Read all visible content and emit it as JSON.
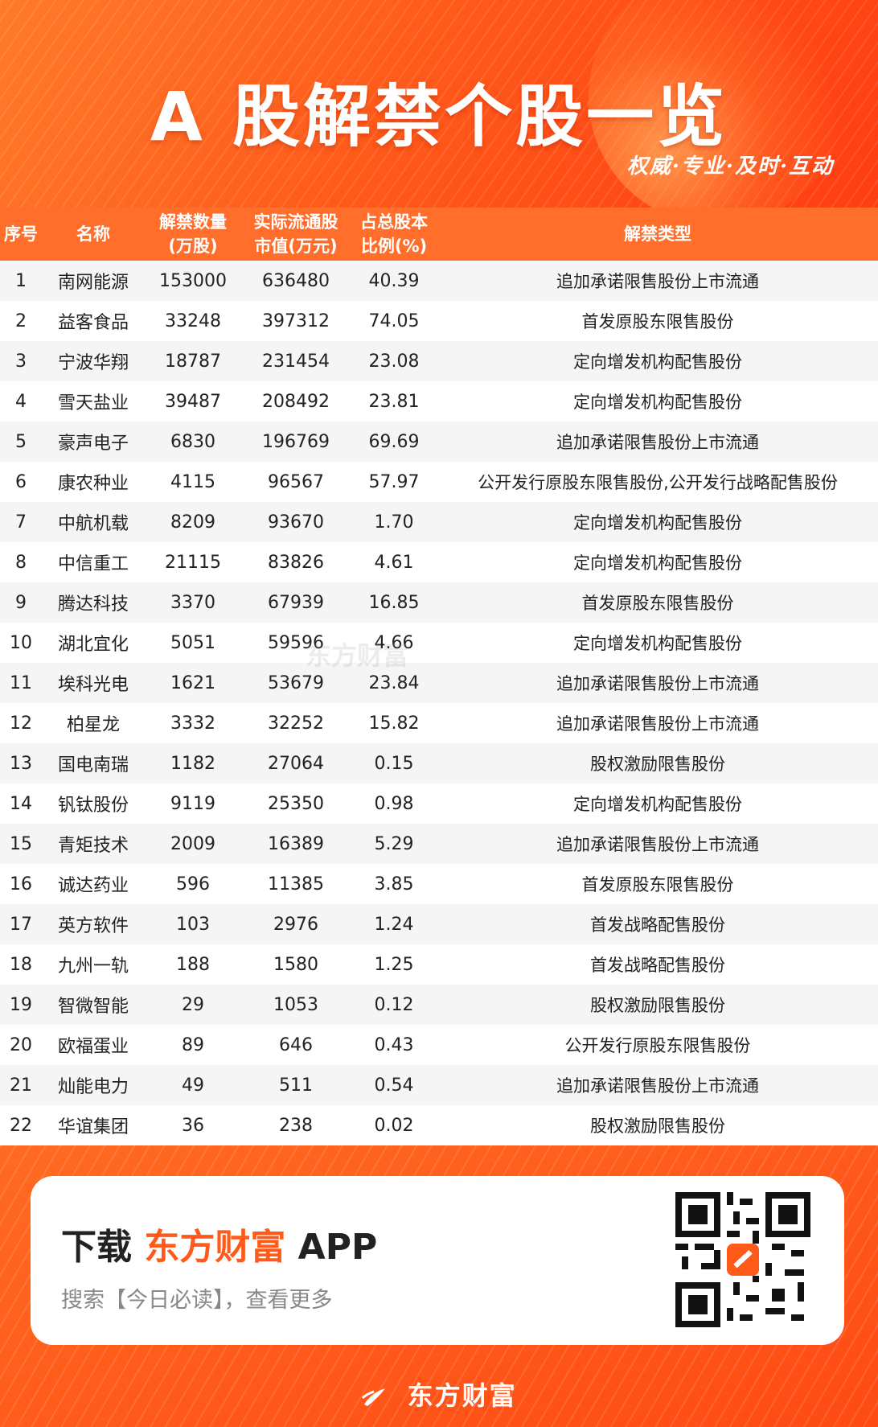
{
  "header": {
    "title": "A 股解禁个股一览",
    "slogan": "权威·专业·及时·互动"
  },
  "table": {
    "columns": {
      "index": "序号",
      "name": "名称",
      "qty_1": "解禁数量",
      "qty_2": "(万股)",
      "value_1": "实际流通股",
      "value_2": "市值(万元)",
      "ratio_1": "占总股本",
      "ratio_2": "比例(%)",
      "type": "解禁类型"
    },
    "rows": [
      {
        "index": "1",
        "name": "南网能源",
        "qty": "153000",
        "value": "636480",
        "ratio": "40.39",
        "type": "追加承诺限售股份上市流通"
      },
      {
        "index": "2",
        "name": "益客食品",
        "qty": "33248",
        "value": "397312",
        "ratio": "74.05",
        "type": "首发原股东限售股份"
      },
      {
        "index": "3",
        "name": "宁波华翔",
        "qty": "18787",
        "value": "231454",
        "ratio": "23.08",
        "type": "定向增发机构配售股份"
      },
      {
        "index": "4",
        "name": "雪天盐业",
        "qty": "39487",
        "value": "208492",
        "ratio": "23.81",
        "type": "定向增发机构配售股份"
      },
      {
        "index": "5",
        "name": "豪声电子",
        "qty": "6830",
        "value": "196769",
        "ratio": "69.69",
        "type": "追加承诺限售股份上市流通"
      },
      {
        "index": "6",
        "name": "康农种业",
        "qty": "4115",
        "value": "96567",
        "ratio": "57.97",
        "type": "公开发行原股东限售股份,公开发行战略配售股份"
      },
      {
        "index": "7",
        "name": "中航机载",
        "qty": "8209",
        "value": "93670",
        "ratio": "1.70",
        "type": "定向增发机构配售股份"
      },
      {
        "index": "8",
        "name": "中信重工",
        "qty": "21115",
        "value": "83826",
        "ratio": "4.61",
        "type": "定向增发机构配售股份"
      },
      {
        "index": "9",
        "name": "腾达科技",
        "qty": "3370",
        "value": "67939",
        "ratio": "16.85",
        "type": "首发原股东限售股份"
      },
      {
        "index": "10",
        "name": "湖北宜化",
        "qty": "5051",
        "value": "59596",
        "ratio": "4.66",
        "type": "定向增发机构配售股份"
      },
      {
        "index": "11",
        "name": "埃科光电",
        "qty": "1621",
        "value": "53679",
        "ratio": "23.84",
        "type": "追加承诺限售股份上市流通"
      },
      {
        "index": "12",
        "name": "柏星龙",
        "qty": "3332",
        "value": "32252",
        "ratio": "15.82",
        "type": "追加承诺限售股份上市流通"
      },
      {
        "index": "13",
        "name": "国电南瑞",
        "qty": "1182",
        "value": "27064",
        "ratio": "0.15",
        "type": "股权激励限售股份"
      },
      {
        "index": "14",
        "name": "钒钛股份",
        "qty": "9119",
        "value": "25350",
        "ratio": "0.98",
        "type": "定向增发机构配售股份"
      },
      {
        "index": "15",
        "name": "青矩技术",
        "qty": "2009",
        "value": "16389",
        "ratio": "5.29",
        "type": "追加承诺限售股份上市流通"
      },
      {
        "index": "16",
        "name": "诚达药业",
        "qty": "596",
        "value": "11385",
        "ratio": "3.85",
        "type": "首发原股东限售股份"
      },
      {
        "index": "17",
        "name": "英方软件",
        "qty": "103",
        "value": "2976",
        "ratio": "1.24",
        "type": "首发战略配售股份"
      },
      {
        "index": "18",
        "name": "九州一轨",
        "qty": "188",
        "value": "1580",
        "ratio": "1.25",
        "type": "首发战略配售股份"
      },
      {
        "index": "19",
        "name": "智微智能",
        "qty": "29",
        "value": "1053",
        "ratio": "0.12",
        "type": "股权激励限售股份"
      },
      {
        "index": "20",
        "name": "欧福蛋业",
        "qty": "89",
        "value": "646",
        "ratio": "0.43",
        "type": "公开发行原股东限售股份"
      },
      {
        "index": "21",
        "name": "灿能电力",
        "qty": "49",
        "value": "511",
        "ratio": "0.54",
        "type": "追加承诺限售股份上市流通"
      },
      {
        "index": "22",
        "name": "华谊集团",
        "qty": "36",
        "value": "238",
        "ratio": "0.02",
        "type": "股权激励限售股份"
      }
    ]
  },
  "watermark": "东方财富",
  "footer": {
    "download_prefix": "下载",
    "brand": "东方财富",
    "app": "APP",
    "subtitle": "搜索【今日必读】，查看更多",
    "logo_text": "东方财富"
  },
  "colors": {
    "accent": "#ff5a1a",
    "header_row": "#ff6f2b",
    "stripe_row": "#f5f5f5"
  }
}
